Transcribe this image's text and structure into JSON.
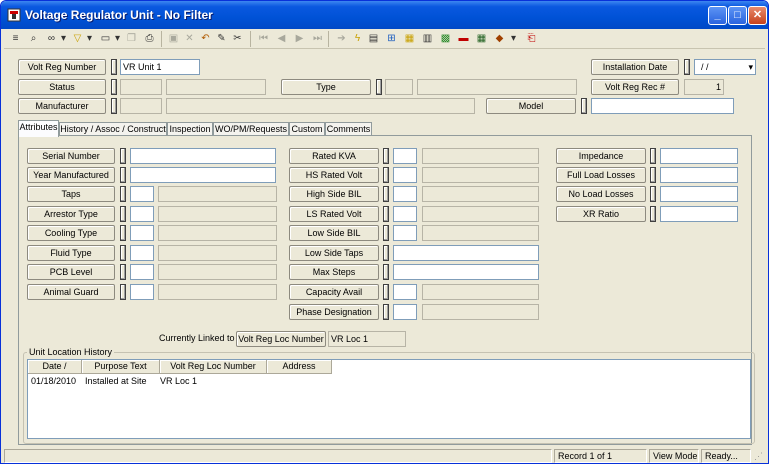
{
  "window": {
    "title": "Voltage Regulator Unit - No Filter",
    "minimize_glyph": "_",
    "maximize_glyph": "□",
    "close_glyph": "✕"
  },
  "toolbar": {
    "icons": [
      "list-icon",
      "find-icon",
      "binoculars-icon",
      "filter-icon",
      "new-record-icon",
      "copy-icon",
      "print-preview-icon",
      "save-icon",
      "delete-icon",
      "undo-icon",
      "edit-icon",
      "cut-icon",
      "first-record-icon",
      "prev-record-icon",
      "next-record-icon",
      "last-record-icon",
      "arrow-icon",
      "lightning-icon",
      "report-icon",
      "tree-icon",
      "chart-icon",
      "calendar-icon",
      "map-icon",
      "eraser-icon",
      "spreadsheet-icon",
      "book-icon",
      "exit-icon"
    ]
  },
  "header": {
    "volt_reg_number_label": "Volt Reg Number",
    "volt_reg_number_value": "VR Unit 1",
    "status_label": "Status",
    "status_code": "",
    "status_desc": "",
    "manufacturer_label": "Manufacturer",
    "manufacturer_code": "",
    "manufacturer_desc": "",
    "type_label": "Type",
    "type_code": "",
    "type_desc": "",
    "model_label": "Model",
    "model_value": "",
    "installation_date_label": "Installation Date",
    "installation_date_value": "/ /",
    "volt_reg_rec_label": "Volt Reg Rec #",
    "volt_reg_rec_value": "1"
  },
  "tabs": [
    {
      "label": "Attributes",
      "active": true
    },
    {
      "label": "History / Assoc / Construct",
      "active": false
    },
    {
      "label": "Inspection",
      "active": false
    },
    {
      "label": "WO/PM/Requests",
      "active": false
    },
    {
      "label": "Custom",
      "active": false
    },
    {
      "label": "Comments",
      "active": false
    }
  ],
  "attributes": {
    "col1": [
      {
        "label": "Serial Number",
        "code": "",
        "desc": ""
      },
      {
        "label": "Year Manufactured",
        "code": "",
        "desc": ""
      },
      {
        "label": "Taps",
        "code": "",
        "desc": ""
      },
      {
        "label": "Arrestor Type",
        "code": "",
        "desc": ""
      },
      {
        "label": "Cooling Type",
        "code": "",
        "desc": ""
      },
      {
        "label": "Fluid Type",
        "code": "",
        "desc": ""
      },
      {
        "label": "PCB Level",
        "code": "",
        "desc": ""
      },
      {
        "label": "Animal Guard",
        "code": "",
        "desc": ""
      }
    ],
    "col2": [
      {
        "label": "Rated KVA",
        "code": "",
        "desc": ""
      },
      {
        "label": "HS Rated Volt",
        "code": "",
        "desc": ""
      },
      {
        "label": "High Side BIL",
        "code": "",
        "desc": ""
      },
      {
        "label": "LS Rated Volt",
        "code": "",
        "desc": ""
      },
      {
        "label": "Low Side BIL",
        "code": "",
        "desc": ""
      },
      {
        "label": "Low Side Taps",
        "code": "",
        "desc": ""
      },
      {
        "label": "Max Steps",
        "code": "",
        "desc": ""
      },
      {
        "label": "Capacity Avail",
        "code": "",
        "desc": ""
      },
      {
        "label": "Phase Designation",
        "code": "",
        "desc": ""
      }
    ],
    "col3": [
      {
        "label": "Impedance",
        "value": ""
      },
      {
        "label": "Full Load Losses",
        "value": ""
      },
      {
        "label": "No Load Losses",
        "value": ""
      },
      {
        "label": "XR Ratio",
        "value": ""
      }
    ]
  },
  "linked": {
    "currently_linked_label": "Currently Linked to",
    "loc_button_label": "Volt Reg Loc Number",
    "loc_value": "VR Loc 1"
  },
  "history": {
    "group_title": "Unit Location History",
    "columns": [
      "Date /",
      "Purpose Text",
      "Volt Reg Loc Number",
      "Address"
    ],
    "rows": [
      {
        "date": "01/18/2010",
        "purpose": "Installed at Site",
        "loc": "VR Loc 1",
        "address": ""
      }
    ]
  },
  "statusbar": {
    "record": "Record 1 of 1",
    "mode": "View Mode",
    "state": "Ready..."
  }
}
